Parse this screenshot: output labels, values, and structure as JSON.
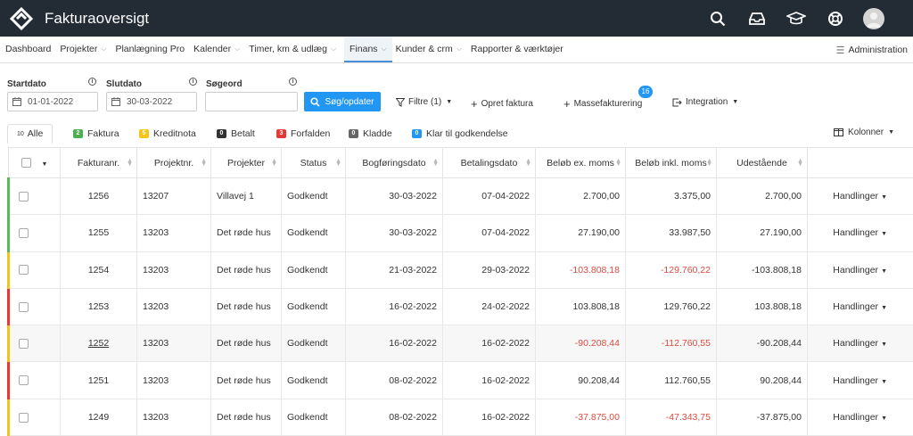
{
  "app": {
    "title": "Fakturaoversigt"
  },
  "topbar": {
    "icons": [
      "search-icon",
      "inbox-icon",
      "graduation-cap-icon",
      "lifebuoy-icon"
    ]
  },
  "nav": {
    "items": [
      {
        "label": "Dashboard",
        "chevron": false
      },
      {
        "label": "Projekter",
        "chevron": true
      },
      {
        "label": "Planlægning Pro",
        "chevron": false
      },
      {
        "label": "Kalender",
        "chevron": true
      },
      {
        "label": "Timer, km & udlæg",
        "chevron": true
      },
      {
        "label": "Finans",
        "chevron": true,
        "active": true
      },
      {
        "label": "Kunder & crm",
        "chevron": true
      },
      {
        "label": "Rapporter & værktøjer",
        "chevron": false
      }
    ],
    "admin_label": "Administration"
  },
  "filters": {
    "startdato_label": "Startdato",
    "startdato_value": "01-01-2022",
    "slutdato_label": "Slutdato",
    "slutdato_value": "30-03-2022",
    "soegeord_label": "Søgeord",
    "soegeord_value": "",
    "search_button": "Søg/opdater",
    "filtre_label": "Filtre (1)",
    "opret_label": "Opret faktura",
    "masse_label": "Massefakturering",
    "masse_badge": "16",
    "integration_label": "Integration"
  },
  "tabs": [
    {
      "count": "10",
      "label": "Alle",
      "color": ""
    },
    {
      "count": "2",
      "label": "Faktura",
      "color": "#4caf50"
    },
    {
      "count": "5",
      "label": "Kreditnota",
      "color": "#f5c518"
    },
    {
      "count": "0",
      "label": "Betalt",
      "color": "#333333"
    },
    {
      "count": "3",
      "label": "Forfalden",
      "color": "#e53935"
    },
    {
      "count": "0",
      "label": "Kladde",
      "color": "#666666"
    },
    {
      "count": "0",
      "label": "Klar til godkendelse",
      "color": "#2196f3"
    }
  ],
  "kolonner_label": "Kolonner",
  "table": {
    "columns": [
      "Fakturanr.",
      "Projektnr.",
      "Projekter",
      "Status",
      "Bogføringsdato",
      "Betalingsdato",
      "Beløb ex. moms",
      "Beløb inkl. moms",
      "Udestående"
    ],
    "rows": [
      {
        "nr": "1256",
        "projnr": "13207",
        "projekt": "Villavej 1",
        "status": "Godkendt",
        "bogf": "30-03-2022",
        "betal": "07-04-2022",
        "ex": "2.700,00",
        "inkl": "3.375,00",
        "udest": "2.700,00",
        "bar": "#5cb85c",
        "neg": false,
        "link": false
      },
      {
        "nr": "1255",
        "projnr": "13203",
        "projekt": "Det røde hus",
        "status": "Godkendt",
        "bogf": "30-03-2022",
        "betal": "07-04-2022",
        "ex": "27.190,00",
        "inkl": "33.987,50",
        "udest": "27.190,00",
        "bar": "#5cb85c",
        "neg": false,
        "link": false
      },
      {
        "nr": "1254",
        "projnr": "13203",
        "projekt": "Det røde hus",
        "status": "Godkendt",
        "bogf": "21-03-2022",
        "betal": "29-03-2022",
        "ex": "-103.808,18",
        "inkl": "-129.760,22",
        "udest": "-103.808,18",
        "bar": "#f0c419",
        "neg": true,
        "link": false
      },
      {
        "nr": "1253",
        "projnr": "13203",
        "projekt": "Det røde hus",
        "status": "Godkendt",
        "bogf": "16-02-2022",
        "betal": "24-02-2022",
        "ex": "103.808,18",
        "inkl": "129.760,22",
        "udest": "103.808,18",
        "bar": "#e53935",
        "neg": false,
        "link": false
      },
      {
        "nr": "1252",
        "projnr": "13203",
        "projekt": "Det røde hus",
        "status": "Godkendt",
        "bogf": "16-02-2022",
        "betal": "16-02-2022",
        "ex": "-90.208,44",
        "inkl": "-112.760,55",
        "udest": "-90.208,44",
        "bar": "#f0c419",
        "neg": true,
        "link": true
      },
      {
        "nr": "1251",
        "projnr": "13203",
        "projekt": "Det røde hus",
        "status": "Godkendt",
        "bogf": "08-02-2022",
        "betal": "16-02-2022",
        "ex": "90.208,44",
        "inkl": "112.760,55",
        "udest": "90.208,44",
        "bar": "#e53935",
        "neg": false,
        "link": false
      },
      {
        "nr": "1249",
        "projnr": "13203",
        "projekt": "Det røde hus",
        "status": "Godkendt",
        "bogf": "08-02-2022",
        "betal": "16-02-2022",
        "ex": "-37.875,00",
        "inkl": "-47.343,75",
        "udest": "-37.875,00",
        "bar": "#f0c419",
        "neg": true,
        "link": false
      }
    ],
    "action_label": "Handlinger"
  }
}
